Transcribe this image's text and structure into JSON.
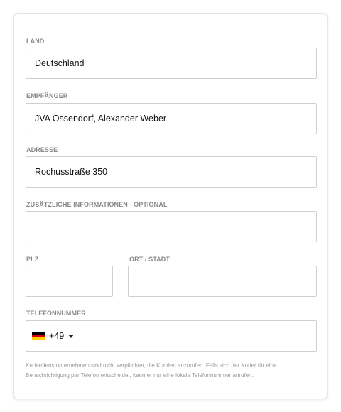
{
  "fields": {
    "country": {
      "label": "LAND",
      "value": "Deutschland"
    },
    "recipient": {
      "label": "EMPFÄNGER",
      "value": "JVA Ossendorf, Alexander Weber"
    },
    "address": {
      "label": "ADRESSE",
      "value": "Rochusstraße 350"
    },
    "additional": {
      "label": "ZUSÄTZLICHE INFORMATIONEN - OPTIONAL",
      "value": ""
    },
    "zip": {
      "label": "PLZ",
      "value": ""
    },
    "city": {
      "label": "ORT / STADT",
      "value": ""
    },
    "phone": {
      "label": "TELEFONNUMMER",
      "dial_code": "+49",
      "country_flag_icon": "germany-flag-icon",
      "value": ""
    }
  },
  "hint": "Kurierdienstunternehmen sind nicht verpflichtet, die Kunden anzurufen. Falls sich der Kurier für eine Benachrichtigung per Telefon entscheidet, kann er nur eine lokale Telefonnummer anrufen.",
  "colors": {
    "label": "#8a8a8a",
    "border": "#cfcfcf",
    "hint": "#9a9a9a",
    "flag": [
      "#000000",
      "#dd0000",
      "#ffce00"
    ]
  }
}
